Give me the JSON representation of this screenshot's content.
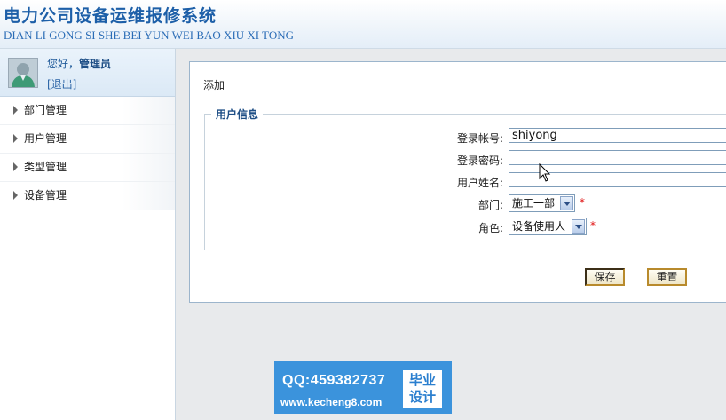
{
  "header": {
    "title_cn": "电力公司设备运维报修系统",
    "title_pinyin": "DIAN LI GONG SI SHE BEI YUN WEI BAO XIU XI TONG"
  },
  "user_panel": {
    "greeting": "您好，",
    "role": "管理员",
    "logout": "[退出]"
  },
  "sidebar": {
    "items": [
      {
        "label": "部门管理"
      },
      {
        "label": "用户管理"
      },
      {
        "label": "类型管理"
      },
      {
        "label": "设备管理"
      }
    ]
  },
  "form": {
    "heading": "添加",
    "legend": "用户信息",
    "login_account": {
      "label": "登录帐号:",
      "value": "shiyong"
    },
    "login_password": {
      "label": "登录密码:",
      "value": ""
    },
    "user_name": {
      "label": "用户姓名:",
      "value": ""
    },
    "department": {
      "label": "部门:",
      "selected": "施工一部",
      "required_mark": "*"
    },
    "role": {
      "label": "角色:",
      "selected": "设备使用人",
      "required_mark": "*"
    },
    "save_label": "保存",
    "reset_label": "重置"
  },
  "watermark": {
    "qq": "QQ:459382737",
    "site": "www.kecheng8.com",
    "badge_line1": "毕业",
    "badge_line2": "设计"
  },
  "colors": {
    "brand_blue": "#1d5fa8",
    "required_red": "#e01010",
    "button_border": "#b88a2c",
    "banner_blue": "#3b93dc"
  }
}
